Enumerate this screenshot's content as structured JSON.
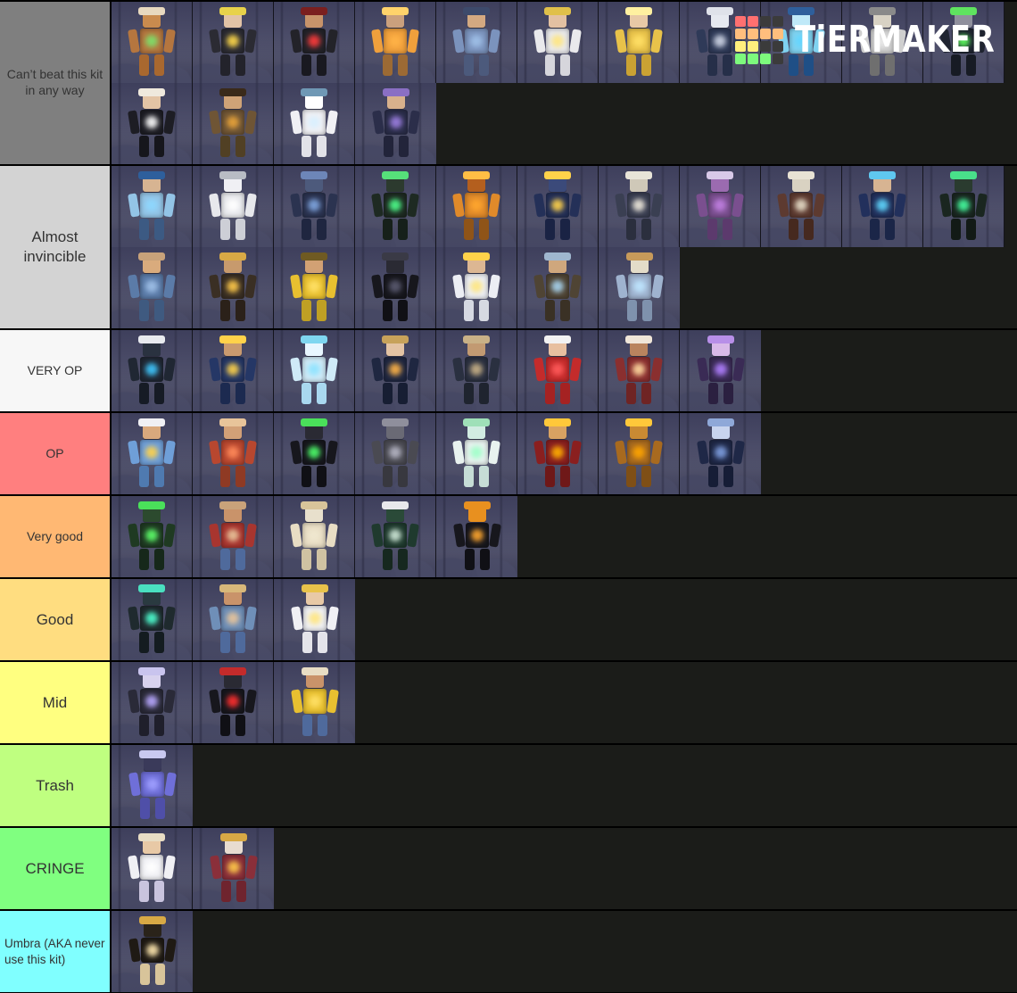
{
  "app": {
    "name": "TierMaker",
    "logo_word": "TiERMAKER",
    "background_color": "#1b1c19",
    "logo_colors": {
      "red": "#ff7070",
      "orange": "#ffbe7d",
      "yellow": "#ffef7d",
      "green": "#7dfa7d",
      "dark": "#3b3b3b"
    },
    "logo_grid": [
      [
        "red",
        "red",
        "dark",
        "dark"
      ],
      [
        "orange",
        "orange",
        "orange",
        "orange"
      ],
      [
        "yellow",
        "yellow",
        "dark",
        "dark"
      ],
      [
        "green",
        "green",
        "green",
        "dark"
      ]
    ]
  },
  "tiers": [
    {
      "label": "Can’t beat this kit in any way",
      "color": "#7f7f7f",
      "label_size": "small",
      "item_count": 15,
      "items": [
        {
          "name": "gingerbread-kit",
          "main": "#b5763f",
          "accent": "#e8d9bf",
          "skin": "#c98b4e",
          "legs": "#a9682f",
          "glow": "#7de06a"
        },
        {
          "name": "black-gold-kit",
          "main": "#2b2b33",
          "accent": "#e8d24a",
          "skin": "#e2c3a6",
          "legs": "#23232b",
          "glow": "#ffd94a"
        },
        {
          "name": "crimson-dark-kit",
          "main": "#232329",
          "accent": "#7a1f1f",
          "skin": "#c7936a",
          "legs": "#191920",
          "glow": "#ff3b3b"
        },
        {
          "name": "orange-sun-kit",
          "main": "#f0a03c",
          "accent": "#ffd36b",
          "skin": "#caa07d",
          "legs": "#9c6a34",
          "glow": "#ffb347"
        },
        {
          "name": "blue-traveler-kit",
          "main": "#7b93bd",
          "accent": "#3d4a6b",
          "skin": "#d3a981",
          "legs": "#4c5a7c",
          "glow": "#9fc0e8"
        },
        {
          "name": "white-gold-kit",
          "main": "#e9e9ec",
          "accent": "#e0c04a",
          "skin": "#e3c1a2",
          "legs": "#d6d6dc",
          "glow": "#ffe680"
        },
        {
          "name": "golden-knight-kit",
          "main": "#e8c24a",
          "accent": "#fff0a0",
          "skin": "#e8c9a6",
          "legs": "#caa233",
          "glow": "#ffe066"
        },
        {
          "name": "ghostface-kit",
          "main": "#2f3a58",
          "accent": "#dfe2ea",
          "skin": "#e6e9f0",
          "legs": "#262f49",
          "glow": "#cfd6e6"
        },
        {
          "name": "ice-dragon-kit",
          "main": "#7fd2f0",
          "accent": "#2e5f9c",
          "skin": "#bfe9f8",
          "legs": "#1f4f86",
          "glow": "#63d6ff"
        },
        {
          "name": "snow-hood-kit",
          "main": "#cfcfcf",
          "accent": "#8a8a8a",
          "skin": "#d8d2c4",
          "legs": "#6f6f6f",
          "glow": "#eaeaea"
        },
        {
          "name": "green-reaper-kit",
          "main": "#1f2430",
          "accent": "#5fe35f",
          "skin": "#8f8f9c",
          "legs": "#171b24",
          "glow": "#5dff5d"
        },
        {
          "name": "white-hair-kit",
          "main": "#1d1d24",
          "accent": "#efe9dd",
          "skin": "#e3c4a5",
          "legs": "#16161c",
          "glow": "#ffffff"
        },
        {
          "name": "cowboy-kit",
          "main": "#6f5535",
          "accent": "#3a2a1a",
          "skin": "#cfa377",
          "legs": "#514024",
          "glow": "#e8a33a"
        },
        {
          "name": "snowman-kit",
          "main": "#f0f0f4",
          "accent": "#6f98b5",
          "skin": "#ffffff",
          "legs": "#e2e2e8",
          "glow": "#d9f0ff"
        },
        {
          "name": "samurai-purple-kit",
          "main": "#2b2e4a",
          "accent": "#8a6fc4",
          "skin": "#d8b18c",
          "legs": "#22243a",
          "glow": "#9b7ee0"
        }
      ]
    },
    {
      "label": "Almost invincible",
      "color": "#d3d3d3",
      "label_size": "normal",
      "item_count": 18,
      "items": [
        {
          "name": "frost-hood-kit",
          "main": "#93c4e6",
          "accent": "#2e5f9c",
          "skin": "#d7b492",
          "legs": "#3c5a83",
          "glow": "#8ed8ff"
        },
        {
          "name": "white-snow-kit",
          "main": "#e7e8ec",
          "accent": "#b8bcc4",
          "skin": "#f0f0f4",
          "legs": "#cdcfd6",
          "glow": "#ffffff"
        },
        {
          "name": "dark-blue-kit",
          "main": "#2b3350",
          "accent": "#6d86b8",
          "skin": "#4d5a7c",
          "legs": "#1f2640",
          "glow": "#7fa6e0"
        },
        {
          "name": "green-sorcerer-kit",
          "main": "#1e2a22",
          "accent": "#56e07a",
          "skin": "#2c3a2e",
          "legs": "#16201a",
          "glow": "#4dff8a"
        },
        {
          "name": "orange-demon-kit",
          "main": "#e08a2a",
          "accent": "#ffbe45",
          "skin": "#b45f1e",
          "legs": "#8f5418",
          "glow": "#ffa62e"
        },
        {
          "name": "cosmic-blue-kit",
          "main": "#243058",
          "accent": "#ffd24a",
          "skin": "#3b4a7a",
          "legs": "#1a2344",
          "glow": "#ffd24a"
        },
        {
          "name": "bull-skull-kit",
          "main": "#3a3f52",
          "accent": "#e8e4d8",
          "skin": "#cfc8b8",
          "legs": "#2b2f3e",
          "glow": "#efe9dc"
        },
        {
          "name": "purple-demon-kit",
          "main": "#7a4f8f",
          "accent": "#d8c9e8",
          "skin": "#9b6bb0",
          "legs": "#5c3a6d",
          "glow": "#c07fe0"
        },
        {
          "name": "skull-wanderer-kit",
          "main": "#5d3a30",
          "accent": "#e8e2d4",
          "skin": "#d9d2c2",
          "legs": "#46291f",
          "glow": "#e6ddc8"
        },
        {
          "name": "blue-wizard-kit",
          "main": "#22305c",
          "accent": "#5fc8f0",
          "skin": "#d7b492",
          "legs": "#1b2648",
          "glow": "#5fd8ff"
        },
        {
          "name": "toxic-green-kit",
          "main": "#1a2620",
          "accent": "#49e08a",
          "skin": "#2a3b2f",
          "legs": "#121a16",
          "glow": "#45ffa0"
        },
        {
          "name": "villager-blue-kit",
          "main": "#5b7ba8",
          "accent": "#c8a27a",
          "skin": "#d9ab7d",
          "legs": "#3f5a80",
          "glow": "#9fc0e8"
        },
        {
          "name": "gold-musket-kit",
          "main": "#3a2f24",
          "accent": "#d8a945",
          "skin": "#c79a6d",
          "legs": "#2b2119",
          "glow": "#ffc94a"
        },
        {
          "name": "yellow-worker-kit",
          "main": "#e8c030",
          "accent": "#6f5a22",
          "skin": "#d2a174",
          "legs": "#bfa024",
          "glow": "#ffe066"
        },
        {
          "name": "black-scythe-kit",
          "main": "#17171d",
          "accent": "#3a3a46",
          "skin": "#2a2a33",
          "legs": "#101015",
          "glow": "#5a5a70"
        },
        {
          "name": "starlight-kit",
          "main": "#eceef4",
          "accent": "#ffd24a",
          "skin": "#dcb793",
          "legs": "#d6d9e2",
          "glow": "#ffe680"
        },
        {
          "name": "brown-gunner-kit",
          "main": "#4f4434",
          "accent": "#9fb7cf",
          "skin": "#cfa77d",
          "legs": "#3a3125",
          "glow": "#a8d4ef"
        },
        {
          "name": "ice-paladin-kit",
          "main": "#9fb3cf",
          "accent": "#c79a5a",
          "skin": "#e3dcc9",
          "legs": "#7f92ad",
          "glow": "#bfe6ff"
        }
      ]
    },
    {
      "label": "VERY OP",
      "color": "#f7f7f7",
      "label_size": "small",
      "item_count": 8,
      "items": [
        {
          "name": "cyber-tech-kit",
          "main": "#202733",
          "accent": "#e8eaef",
          "skin": "#2a3240",
          "legs": "#161b25",
          "glow": "#3fc8ff"
        },
        {
          "name": "noble-blue-kit",
          "main": "#253766",
          "accent": "#ffd24a",
          "skin": "#c99a6f",
          "legs": "#1c2a50",
          "glow": "#ffd24a"
        },
        {
          "name": "ice-queen-kit",
          "main": "#cfeaf7",
          "accent": "#7fd6f0",
          "skin": "#e8f6ff",
          "legs": "#a9d8ef",
          "glow": "#8fe4ff"
        },
        {
          "name": "white-prince-kit",
          "main": "#1f2741",
          "accent": "#c7a25a",
          "skin": "#e3c3a3",
          "legs": "#171e33",
          "glow": "#ffb347"
        },
        {
          "name": "detector-kit",
          "main": "#2a3040",
          "accent": "#c9b187",
          "skin": "#c29a72",
          "legs": "#1f242f",
          "glow": "#c9b187"
        },
        {
          "name": "santa-kit",
          "main": "#c42b2b",
          "accent": "#f2f2f2",
          "skin": "#e8c0a0",
          "legs": "#a52222",
          "glow": "#ff5a5a"
        },
        {
          "name": "shrine-maiden-kit",
          "main": "#8a2f2f",
          "accent": "#f0e6d8",
          "skin": "#b9845e",
          "legs": "#6f2424",
          "glow": "#ffd9a0"
        },
        {
          "name": "spirit-purple-kit",
          "main": "#3a2b55",
          "accent": "#b88fe8",
          "skin": "#d9b9e8",
          "legs": "#2b2040",
          "glow": "#b07fff"
        }
      ]
    },
    {
      "label": "OP",
      "color": "#ff7f7f",
      "label_size": "small",
      "item_count": 8,
      "items": [
        {
          "name": "bunny-adventurer-kit",
          "main": "#6f9fd8",
          "accent": "#f0f0f4",
          "skin": "#d9a97d",
          "legs": "#4f7ab0",
          "glow": "#ffd24a"
        },
        {
          "name": "red-scarf-kit",
          "main": "#b8472f",
          "accent": "#e8c49a",
          "skin": "#d2a077",
          "legs": "#8f3a24",
          "glow": "#ff8a5a"
        },
        {
          "name": "black-green-kit",
          "main": "#17171d",
          "accent": "#4ae05a",
          "skin": "#2a2a33",
          "legs": "#101015",
          "glow": "#4dff6a"
        },
        {
          "name": "heavy-armor-kit",
          "main": "#4a4a52",
          "accent": "#8f8f9c",
          "skin": "#6a6a75",
          "legs": "#38383f",
          "glow": "#b5b5c4"
        },
        {
          "name": "white-mint-kit",
          "main": "#e8f2ef",
          "accent": "#9fe0b8",
          "skin": "#d2ece2",
          "legs": "#c6ddd6",
          "glow": "#9fffc8"
        },
        {
          "name": "flame-knight-kit",
          "main": "#8a1f1f",
          "accent": "#ffc83a",
          "skin": "#d8a262",
          "legs": "#6f1818",
          "glow": "#ffb000"
        },
        {
          "name": "golden-dragon-kit",
          "main": "#a86a1f",
          "accent": "#ffc83a",
          "skin": "#c98a33",
          "legs": "#7f4f16",
          "glow": "#ffa500"
        },
        {
          "name": "navy-suit-kit",
          "main": "#1f2847",
          "accent": "#8fa8d8",
          "skin": "#c9d4ee",
          "legs": "#161d36",
          "glow": "#7f9fe0"
        }
      ]
    },
    {
      "label": "Very good",
      "color": "#ffb873",
      "label_size": "small",
      "item_count": 5,
      "items": [
        {
          "name": "nature-golem-kit",
          "main": "#1f3a22",
          "accent": "#4ae05a",
          "skin": "#2c4a2e",
          "legs": "#16281a",
          "glow": "#5dff6a"
        },
        {
          "name": "guitarist-kit",
          "main": "#a8352f",
          "accent": "#c9a27a",
          "skin": "#c9936a",
          "legs": "#4f6a9c",
          "glow": "#e8c49a"
        },
        {
          "name": "mummy-kit",
          "main": "#e8ddc4",
          "accent": "#d8c49a",
          "skin": "#e8e0cc",
          "legs": "#cfc2a2",
          "glow": "#f0e8d0"
        },
        {
          "name": "dark-green-kit",
          "main": "#1f3a2e",
          "accent": "#e8e8ec",
          "skin": "#2a4a38",
          "legs": "#16281f",
          "glow": "#cfe8d8"
        },
        {
          "name": "pumpkin-kit",
          "main": "#17171d",
          "accent": "#e8901f",
          "skin": "#e8901f",
          "legs": "#101015",
          "glow": "#ffa62e"
        }
      ]
    },
    {
      "label": "Good",
      "color": "#ffdd80",
      "label_size": "normal",
      "item_count": 3,
      "items": [
        {
          "name": "shadow-teal-kit",
          "main": "#1f2a2e",
          "accent": "#4ae0c0",
          "skin": "#2a3a40",
          "legs": "#141c20",
          "glow": "#4dffd0"
        },
        {
          "name": "straw-hat-kit",
          "main": "#6f8fb8",
          "accent": "#d8b87a",
          "skin": "#c9936a",
          "legs": "#4f6a9c",
          "glow": "#e8c49a"
        },
        {
          "name": "white-gold-suit-kit",
          "main": "#f0f0f4",
          "accent": "#e8c24a",
          "skin": "#e8c9a6",
          "legs": "#e4e4ea",
          "glow": "#ffe680"
        }
      ]
    },
    {
      "label": "Mid",
      "color": "#ffff80",
      "label_size": "normal",
      "item_count": 3,
      "items": [
        {
          "name": "white-hair-blade-kit",
          "main": "#2a2a38",
          "accent": "#c9c4ee",
          "skin": "#d8d2ee",
          "legs": "#1f1f2b",
          "glow": "#b8a8ff"
        },
        {
          "name": "red-eye-demon-kit",
          "main": "#17171d",
          "accent": "#c42b2b",
          "skin": "#2a2a33",
          "legs": "#101015",
          "glow": "#ff2e2e"
        },
        {
          "name": "construction-kit",
          "main": "#e8c030",
          "accent": "#e8ddc4",
          "skin": "#c9936a",
          "legs": "#4f6a9c",
          "glow": "#ffe066"
        }
      ]
    },
    {
      "label": "Trash",
      "color": "#bfff80",
      "label_size": "normal",
      "item_count": 1,
      "items": [
        {
          "name": "blue-assassin-kit",
          "main": "#6f6fd8",
          "accent": "#c9c9f0",
          "skin": "#3a3a5a",
          "legs": "#4f4fa8",
          "glow": "#9f9fff"
        }
      ]
    },
    {
      "label": "CRINGE",
      "color": "#80ff80",
      "label_size": "normal",
      "item_count": 2,
      "items": [
        {
          "name": "white-straw-hat-kit",
          "main": "#f0f0f4",
          "accent": "#e8ddc4",
          "skin": "#e8c9a6",
          "legs": "#c9c4de",
          "glow": "#ffffff"
        },
        {
          "name": "red-robe-kit",
          "main": "#8a2f3a",
          "accent": "#d8a945",
          "skin": "#e8dcd0",
          "legs": "#6f242e",
          "glow": "#ffc94a"
        }
      ]
    },
    {
      "label": "Umbra (AKA never use this kit)",
      "color": "#80ffff",
      "label_size": "xsmall",
      "item_count": 1,
      "items": [
        {
          "name": "umbra-kit",
          "main": "#1f1a14",
          "accent": "#d8a945",
          "skin": "#2a231a",
          "legs": "#d8c49a",
          "glow": "#ffe8b0"
        }
      ]
    }
  ]
}
